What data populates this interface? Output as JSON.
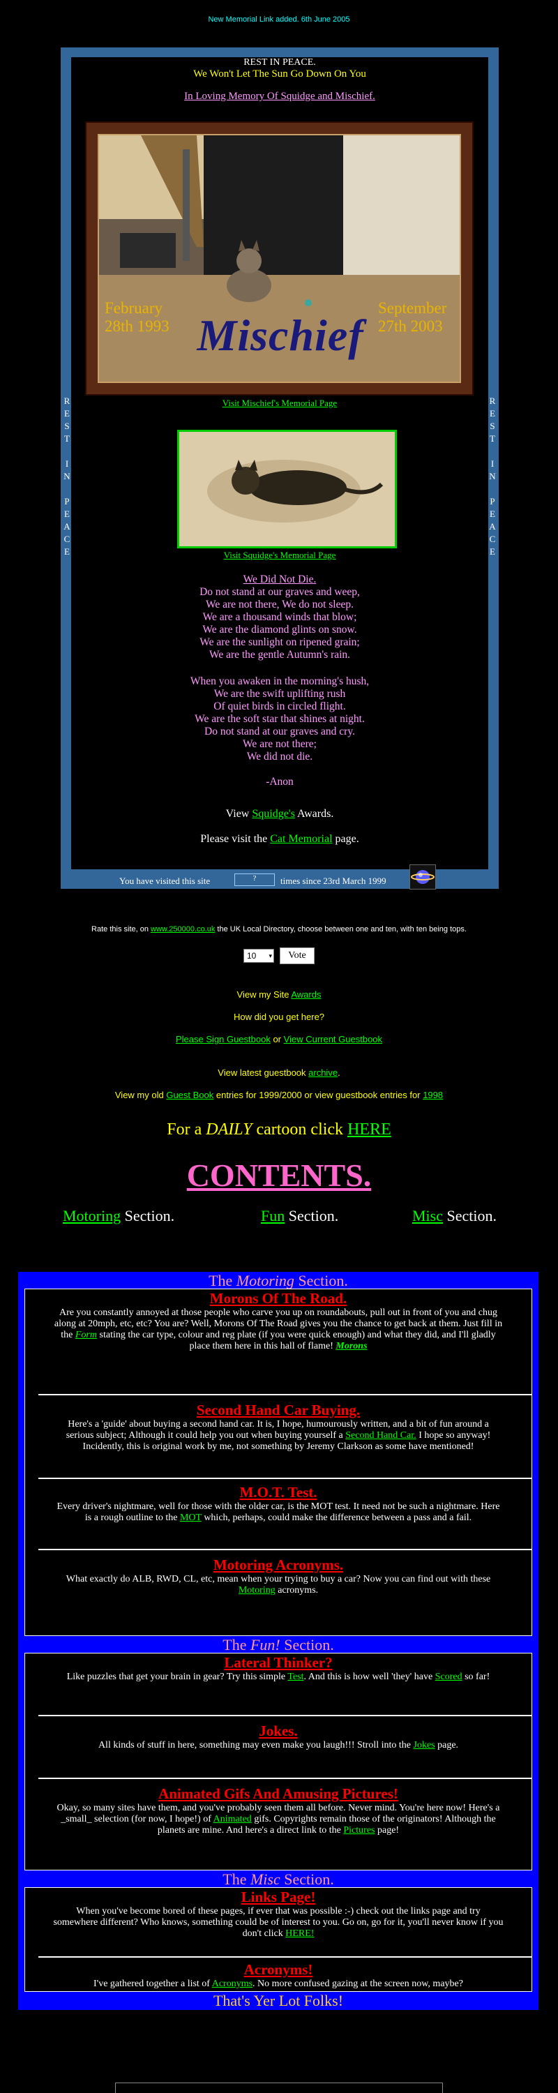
{
  "notice": "New Memorial Link added. 6th June 2005",
  "memorial": {
    "rest_in_peace": "REST IN PEACE.",
    "sun_line": "We Won't Let The Sun Go Down On You",
    "loving_memory": "In Loving Memory Of Squidge and Mischief.",
    "side_text": "R E S T I N P E A C E",
    "photo_name": "Mischief",
    "photo_left": "February 28th 1993",
    "photo_right": "September 27th 2003",
    "mischief_link": "Visit Mischief's Memorial Page",
    "squidge_link": "Visit Squidge's Memorial Page",
    "poem_title": "We Did Not Die.",
    "poem_stanza1": [
      "Do not stand at our graves and weep,",
      "We are not there, We do not sleep.",
      "We are a thousand winds that blow;",
      "We are the diamond glints on snow.",
      "We are the sunlight on ripened grain;",
      "We are the gentle Autumn's rain."
    ],
    "poem_stanza2": [
      "When you awaken in the morning's hush,",
      "We are the swift uplifting rush",
      "Of quiet birds in circled flight.",
      "We are the soft star that shines at night.",
      "Do not stand at our graves and cry.",
      "We are not there;",
      "We did not die."
    ],
    "poem_author": "-Anon",
    "awards_prefix": "View ",
    "awards_link": "Squidge's",
    "awards_suffix": " Awards.",
    "cat_prefix": "Please visit the ",
    "cat_link": "Cat Memorial",
    "cat_suffix": " page.",
    "counter_prefix": "You have visited this site",
    "counter_value": "?",
    "counter_suffix": "times since 23rd March 1999"
  },
  "rate": {
    "prefix": "Rate this site, on ",
    "link": "www.250000.co.uk",
    "suffix": " the UK Local Directory, choose between one and ten, with ten being tops.",
    "select_value": "10",
    "vote_label": "Vote"
  },
  "links": {
    "awards_prefix": "View my Site ",
    "awards_link": "Awards",
    "how_here": "How did you get here?",
    "sign_guestbook": "Please Sign Guestbook",
    "or": " or ",
    "view_guestbook": "View Current Guestbook",
    "archive_prefix": "View latest guestbook ",
    "archive_link": "archive",
    "old_prefix": "View my old ",
    "old_link": "Guest Book",
    "old_mid": " entries for 1999/2000 or view guestbook entries for ",
    "old_1998": "1998",
    "cartoon_prefix": "For a ",
    "cartoon_daily": "DAILY",
    "cartoon_mid": " cartoon click ",
    "cartoon_link": "HERE"
  },
  "contents": {
    "title": "CONTENTS.",
    "motoring": "Motoring",
    "fun": "Fun",
    "misc": "Misc",
    "section_word": " Section."
  },
  "sections": {
    "motoring_title_pre": "The ",
    "motoring_title_em": "Motoring",
    "fun_title_em": "Fun!",
    "misc_title_em": "Misc",
    "title_post": " Section.",
    "morons": {
      "heading": "Morons Of The Road.",
      "text": "Are you constantly annoyed at those people who carve you up on roundabouts, pull out in front of you and chug along at 20mph, etc, etc? You are? Well, Morons Of The Road gives you the chance to get back at them. Just fill in the ",
      "link1": "Form",
      "text2": " stating the car type, colour and reg plate (if you were quick enough) and what they did, and I'll gladly place them here in this hall of flame! ",
      "link2": "Morons"
    },
    "secondhand": {
      "heading": "Second Hand Car Buying.",
      "text": "Here's a 'guide' about buying a second hand car. It is, I hope, humourously written, and a bit of fun around a serious subject; Although it could help you out when buying yourself a ",
      "link": "Second Hand Car.",
      "text2": " I hope so anyway! Incidently, this is original work by me, not something by Jeremy Clarkson as some have mentioned!"
    },
    "mot": {
      "heading": "M.O.T. Test.",
      "text": "Every driver's nightmare, well for those with the older car, is the MOT test. It need not be such a nightmare. Here is a rough outline to the ",
      "link": "MOT",
      "text2": " which, perhaps, could make the difference between a pass and a fail."
    },
    "acronyms_motor": {
      "heading": "Motoring Acronyms.",
      "text": "What exactly do ALB, RWD, CL, etc, mean when your trying to buy a car? Now you can find out with these ",
      "link": "Motoring",
      "text2": " acronyms."
    },
    "lateral": {
      "heading": "Lateral Thinker?",
      "text": "Like puzzles that get your brain in gear? Try this simple ",
      "link": "Test",
      "text2": ". And this is how well 'they' have ",
      "link2": "Scored",
      "text3": " so far!"
    },
    "jokes": {
      "heading": "Jokes.",
      "text": "All kinds of stuff in here, something may even make you laugh!!! Stroll into the ",
      "link": "Jokes",
      "text2": " page."
    },
    "gifs": {
      "heading": "Animated Gifs And Amusing Pictures!",
      "text": "Okay, so many sites have them, and you've probably seen them all before. Never mind. You're here now! Here's a _small_ selection (for now, I hope!) of ",
      "link": "Animated",
      "text2": " gifs. Copyrights remain those of the originators! Although the planets are mine. And here's a direct link to the ",
      "link2": "Pictures",
      "text3": " page!"
    },
    "linkspage": {
      "heading": "Links Page!",
      "text": "When you've become bored of these pages, if ever that was possible :-) check out the links page and try somewhere different? Who knows, something could be of interest to you. Go on, go for it, you'll never know if you don't click ",
      "link": "HERE!"
    },
    "acronyms": {
      "heading": "Acronyms!",
      "text": "I've gathered together a list of ",
      "link": "Acronyms",
      "text2": ". No more confused gazing at the screen now, maybe?"
    },
    "footer": "That's Yer Lot Folks!"
  },
  "colors": {
    "memorial_border": "#336699",
    "contents_bg": "#0000ff",
    "link": "#00ff00",
    "heading": "#ff0000",
    "contents_title": "#ff66cc"
  }
}
